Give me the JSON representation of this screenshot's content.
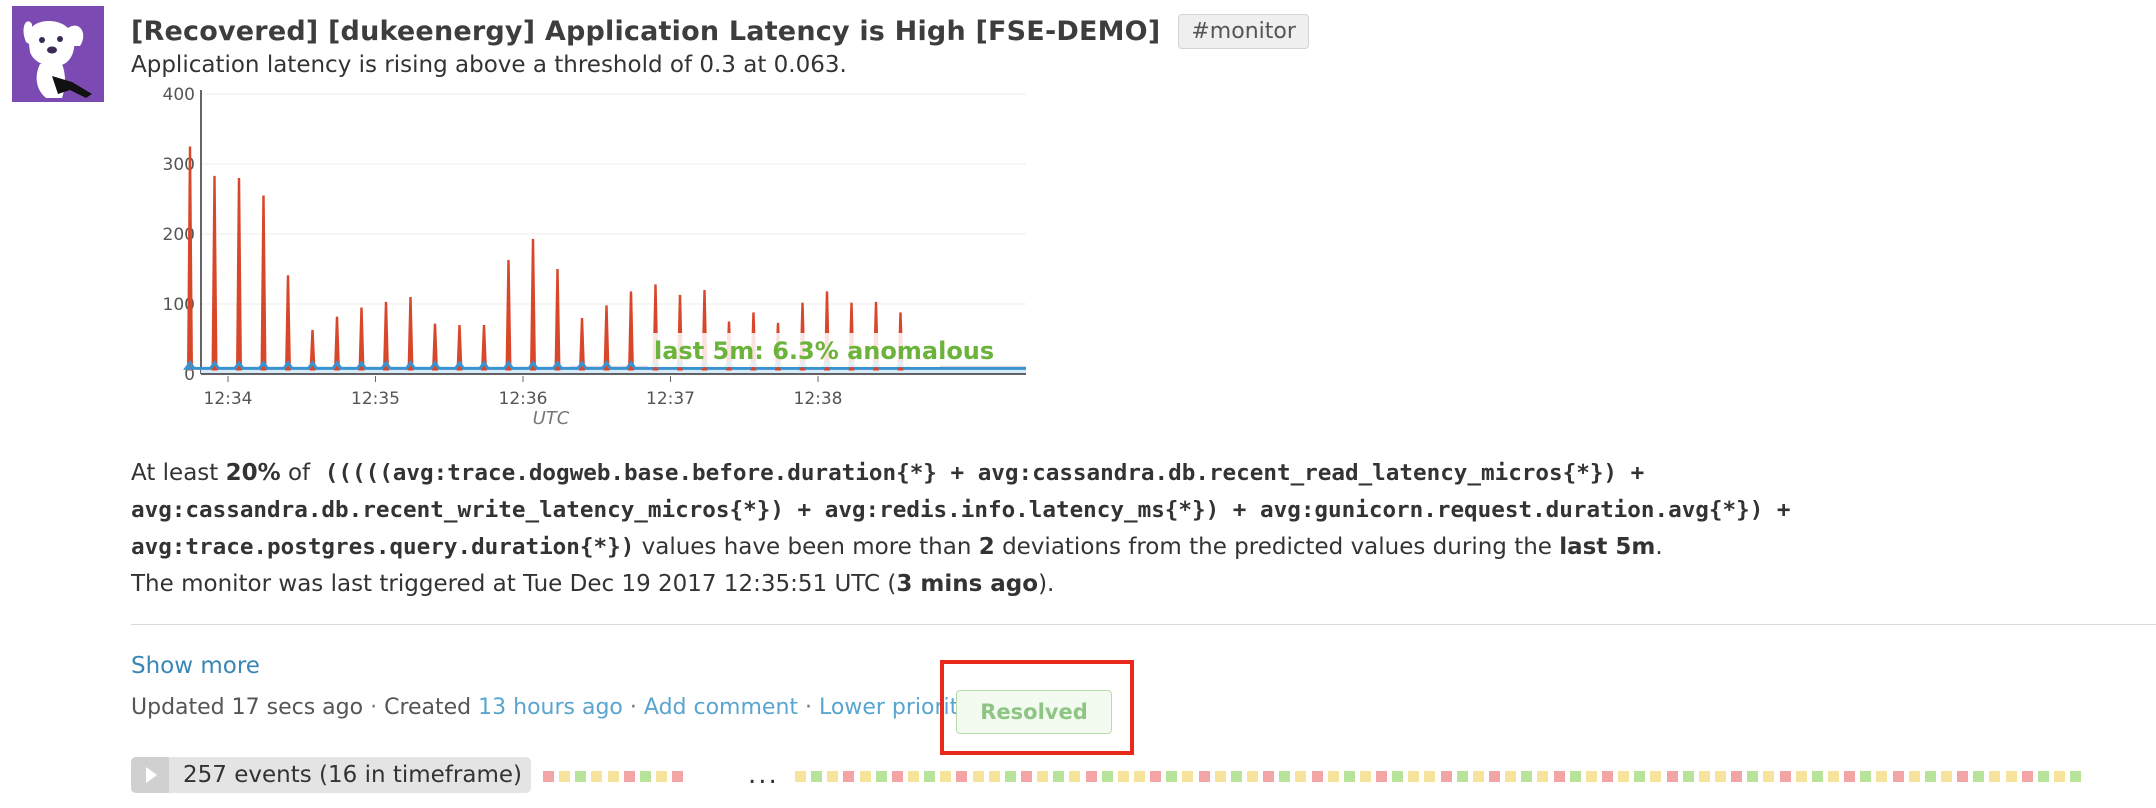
{
  "alert": {
    "title": "[Recovered] [dukeenergy] Application Latency is High [FSE-DEMO]",
    "tag": "#monitor",
    "subtitle": "Application latency is rising above a threshold of 0.3 at 0.063."
  },
  "chart_data": {
    "type": "line",
    "x_ticks": [
      "12:34",
      "12:35",
      "12:36",
      "12:37",
      "12:38"
    ],
    "xlabel": "UTC",
    "ylabel": "",
    "ylim": [
      0,
      400
    ],
    "y_ticks": [
      "0",
      "100",
      "200",
      "300",
      "400"
    ],
    "grid": true,
    "annotation": "last 5m: 6.3% anomalous",
    "series": [
      {
        "color": "#d9472b",
        "values": [
          325,
          283,
          280,
          255,
          141,
          63,
          82,
          95,
          103,
          110,
          72,
          70,
          70,
          163,
          193,
          150,
          80,
          98,
          118,
          128,
          113,
          120,
          75,
          88,
          73,
          102,
          118,
          102,
          103,
          88
        ]
      },
      {
        "color": "#3a93d1",
        "values": [
          8,
          8,
          8,
          8,
          8,
          8,
          8,
          8,
          8,
          8,
          8,
          8,
          8,
          8,
          8,
          8,
          8,
          8,
          8,
          8,
          8,
          8,
          8,
          8,
          8,
          8,
          8,
          8,
          8,
          8
        ]
      }
    ]
  },
  "description": {
    "prefix": "At least",
    "percent": "20%",
    "of": "of",
    "query_line1": "(((((avg:trace.dogweb.base.before.duration{*} + avg:cassandra.db.recent_read_latency_micros{*}) +",
    "query_line2": "avg:cassandra.db.recent_write_latency_micros{*}) + avg:redis.info.latency_ms{*}) + avg:gunicorn.request.duration.avg{*}) +",
    "query_line3": "avg:trace.postgres.query.duration{*})",
    "mid": "values have been more than",
    "deviations": "2",
    "mid2": "deviations from the predicted values during the",
    "window": "last 5m",
    "end": ".",
    "triggered_prefix": "The monitor was last triggered at Tue Dec 19 2017 12:35:51 UTC (",
    "triggered_ago": "3 mins ago",
    "triggered_suffix": ")."
  },
  "actions": {
    "show_more": "Show more",
    "updated": "Updated 17 secs ago",
    "separator": "·",
    "created_label": "Created",
    "created_link": "13 hours ago",
    "add_comment": "Add comment",
    "lower_priority": "Lower priority",
    "resolved": "Resolved"
  },
  "events": {
    "label": "257 events (16 in timeframe)",
    "ellipsis": "...",
    "strip_left_colors": [
      "#f4a4a4",
      "#f6e49a",
      "#b7e39a",
      "#f6e49a",
      "#f6e49a",
      "#f4a4a4",
      "#b7e39a",
      "#f6e49a",
      "#f4a4a4"
    ],
    "strip_right_colors": [
      "#f6e49a",
      "#b7e39a",
      "#f6e49a",
      "#f4a4a4",
      "#f6e49a",
      "#b7e39a",
      "#f4a4a4",
      "#f6e49a",
      "#b7e39a",
      "#f6e49a",
      "#f4a4a4",
      "#f6e49a",
      "#f6e49a",
      "#b7e39a",
      "#f4a4a4",
      "#f6e49a",
      "#b7e39a",
      "#f6e49a",
      "#f4a4a4",
      "#b7e39a",
      "#f6e49a",
      "#f6e49a",
      "#f4a4a4",
      "#b7e39a",
      "#f6e49a",
      "#f4a4a4",
      "#f6e49a",
      "#b7e39a",
      "#f6e49a",
      "#f4a4a4",
      "#b7e39a",
      "#f6e49a",
      "#f4a4a4",
      "#f6e49a",
      "#b7e39a",
      "#f6e49a",
      "#f4a4a4",
      "#b7e39a",
      "#f6e49a",
      "#f6e49a",
      "#f4a4a4",
      "#b7e39a",
      "#f6e49a",
      "#f4a4a4",
      "#f6e49a",
      "#b7e39a",
      "#f6e49a",
      "#f4a4a4",
      "#b7e39a",
      "#f6e49a",
      "#f4a4a4",
      "#f6e49a",
      "#b7e39a",
      "#f6e49a",
      "#f4a4a4",
      "#b7e39a",
      "#f6e49a",
      "#f6e49a",
      "#f4a4a4",
      "#b7e39a",
      "#f6e49a",
      "#f4a4a4",
      "#f6e49a",
      "#b7e39a",
      "#f6e49a",
      "#f4a4a4",
      "#b7e39a",
      "#f6e49a",
      "#f4a4a4",
      "#f6e49a",
      "#b7e39a",
      "#f6e49a",
      "#f4a4a4",
      "#b7e39a",
      "#f6e49a",
      "#f6e49a",
      "#f4a4a4",
      "#b7e39a",
      "#f6e49a",
      "#b7e39a"
    ]
  },
  "icons": {
    "avatar": "datadog-dog-icon",
    "play": "play-triangle-icon"
  }
}
